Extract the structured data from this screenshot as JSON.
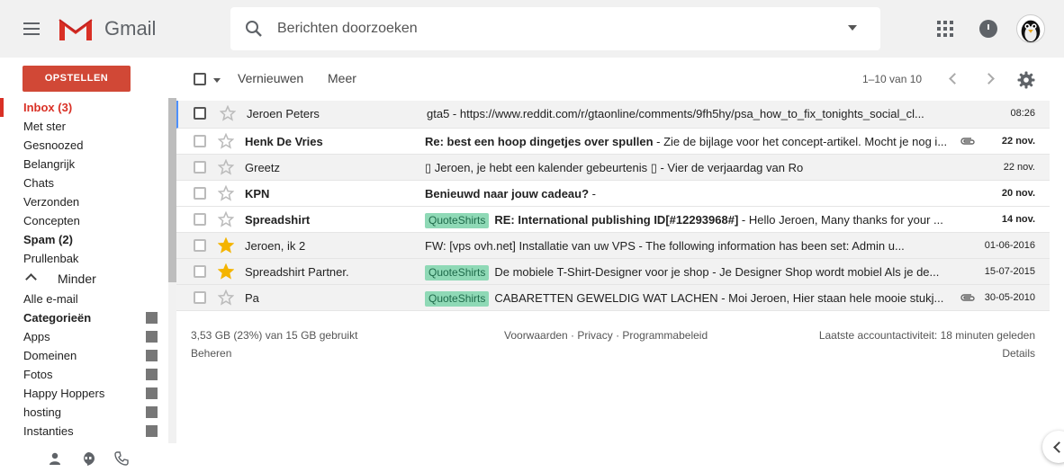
{
  "header": {
    "brand": "Gmail",
    "search_placeholder": "Berichten doorzoeken"
  },
  "sidebar": {
    "compose_label": "OPSTELLEN",
    "items": [
      {
        "label": "Inbox (3)",
        "style": "active"
      },
      {
        "label": "Met ster"
      },
      {
        "label": "Gesnoozed"
      },
      {
        "label": "Belangrijk"
      },
      {
        "label": "Chats"
      },
      {
        "label": "Verzonden"
      },
      {
        "label": "Concepten"
      },
      {
        "label": "Spam (2)",
        "style": "bold"
      },
      {
        "label": "Prullenbak"
      }
    ],
    "less_label": "Minder",
    "more_items": [
      {
        "label": "Alle e-mail"
      },
      {
        "label": "Categorieën",
        "style": "bold"
      },
      {
        "label": "Apps"
      },
      {
        "label": "Domeinen"
      },
      {
        "label": "Fotos"
      },
      {
        "label": "Happy Hoppers"
      },
      {
        "label": "hosting"
      },
      {
        "label": "Instanties"
      }
    ]
  },
  "toolbar": {
    "refresh_label": "Vernieuwen",
    "more_label": "Meer",
    "pager": "1–10 van 10"
  },
  "emails": [
    {
      "sender": "Jeroen Peters",
      "label": "",
      "subject": "",
      "snippet": "gta5 - https://www.reddit.com/r/gtaonline/comments/9fh5hy/psa_how_to_fix_tonights_social_cl...",
      "date": "08:26",
      "unread": false,
      "starred": false,
      "attachment": false,
      "selected": true
    },
    {
      "sender": "Henk De Vries",
      "label": "",
      "subject": "Re: best een hoop dingetjes over spullen",
      "snippet": " - Zie de bijlage voor het concept-artikel. Mocht je nog i...",
      "date": "22 nov.",
      "unread": true,
      "starred": false,
      "attachment": true,
      "selected": false
    },
    {
      "sender": "Greetz",
      "label": "",
      "subject": "",
      "snippet": "▯ Jeroen, je hebt een kalender gebeurtenis ▯ - Vier de verjaardag van Ro",
      "date": "22 nov.",
      "unread": false,
      "starred": false,
      "attachment": false,
      "selected": false
    },
    {
      "sender": "KPN",
      "label": "",
      "subject": "Benieuwd naar jouw cadeau?",
      "snippet": " -",
      "date": "20 nov.",
      "unread": true,
      "starred": false,
      "attachment": false,
      "selected": false
    },
    {
      "sender": "Spreadshirt",
      "label": "QuoteShirts",
      "subject": "RE: International publishing ID[#12293968#]",
      "snippet": " - Hello Jeroen, Many thanks for your ...",
      "date": "14 nov.",
      "unread": true,
      "starred": false,
      "attachment": false,
      "selected": false
    },
    {
      "sender": "Jeroen, ik 2",
      "label": "",
      "subject": "",
      "snippet": "FW: [vps              ovh.net] Installatie van uw VPS - The following information has been set: Admin u...",
      "date": "01-06-2016",
      "unread": false,
      "starred": true,
      "attachment": false,
      "selected": false
    },
    {
      "sender": "Spreadshirt Partner.",
      "label": "QuoteShirts",
      "subject": "",
      "snippet": "De mobiele T-Shirt-Designer voor je shop - Je Designer Shop wordt mobiel Als je de...",
      "date": "15-07-2015",
      "unread": false,
      "starred": true,
      "attachment": false,
      "selected": false
    },
    {
      "sender": "Pa",
      "label": "QuoteShirts",
      "subject": "",
      "snippet": "CABARETTEN GEWELDIG WAT LACHEN - Moi Jeroen, Hier staan hele mooie stukj...",
      "date": "30-05-2010",
      "unread": false,
      "starred": false,
      "attachment": true,
      "selected": false
    }
  ],
  "footer": {
    "storage": "3,53 GB (23%) van 15 GB gebruikt",
    "manage": "Beheren",
    "terms": "Voorwaarden",
    "sep": " · ",
    "privacy": "Privacy",
    "program": "Programmabeleid",
    "activity": "Laatste accountactiviteit: 18 minuten geleden",
    "details": "Details"
  },
  "colors": {
    "accent": "#d14836",
    "label_chip": "#8fd9b6",
    "star": "#f4b400",
    "selected_border": "#4d90fe"
  }
}
